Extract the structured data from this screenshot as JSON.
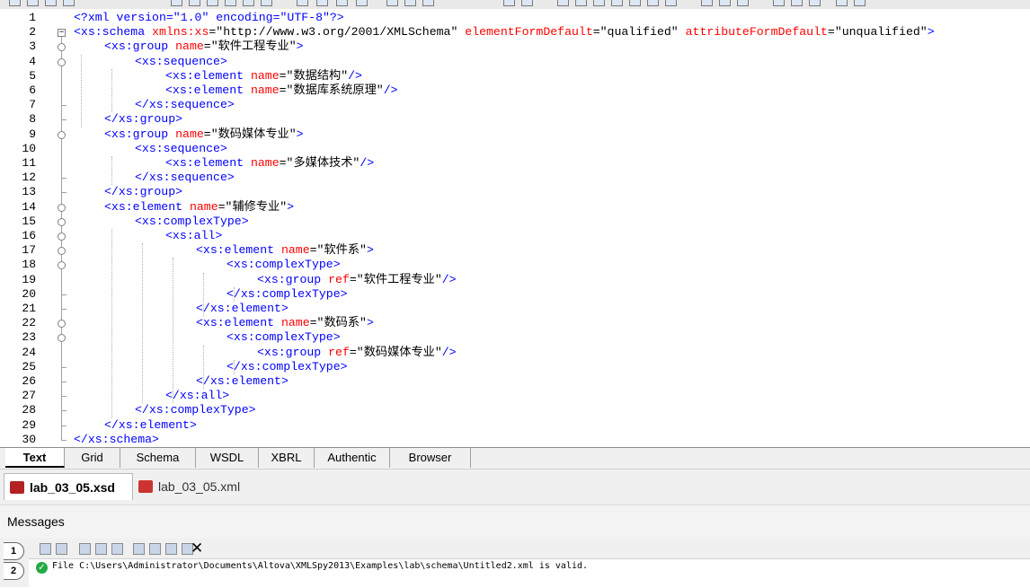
{
  "editor": {
    "line_numbers": [
      "1",
      "2",
      "3",
      "4",
      "5",
      "6",
      "7",
      "8",
      "9",
      "10",
      "11",
      "12",
      "13",
      "14",
      "15",
      "16",
      "17",
      "18",
      "19",
      "20",
      "21",
      "22",
      "23",
      "24",
      "25",
      "26",
      "27",
      "28",
      "29",
      "30"
    ],
    "lines": [
      [
        {
          "c": "pi",
          "t": "<?xml version=\"1.0\" encoding=\"UTF-8\"?>"
        }
      ],
      [
        {
          "c": "t",
          "t": "<xs:schema "
        },
        {
          "c": "a",
          "t": "xmlns:xs"
        },
        {
          "c": "v",
          "t": "=\"http://www.w3.org/2001/XMLSchema\" "
        },
        {
          "c": "a",
          "t": "elementFormDefault"
        },
        {
          "c": "v",
          "t": "=\"qualified\" "
        },
        {
          "c": "a",
          "t": "attributeFormDefault"
        },
        {
          "c": "v",
          "t": "=\"unqualified\""
        },
        {
          "c": "t",
          "t": ">"
        }
      ],
      [
        {
          "c": "t",
          "t": "<xs:group "
        },
        {
          "c": "a",
          "t": "name"
        },
        {
          "c": "v",
          "t": "=\"软件工程专业\""
        },
        {
          "c": "t",
          "t": ">"
        }
      ],
      [
        {
          "c": "t",
          "t": "<xs:sequence>"
        }
      ],
      [
        {
          "c": "t",
          "t": "<xs:element "
        },
        {
          "c": "a",
          "t": "name"
        },
        {
          "c": "v",
          "t": "=\"数据结构\""
        },
        {
          "c": "t",
          "t": "/>"
        }
      ],
      [
        {
          "c": "t",
          "t": "<xs:element "
        },
        {
          "c": "a",
          "t": "name"
        },
        {
          "c": "v",
          "t": "=\"数据库系统原理\""
        },
        {
          "c": "t",
          "t": "/>"
        }
      ],
      [
        {
          "c": "t",
          "t": "</xs:sequence>"
        }
      ],
      [
        {
          "c": "t",
          "t": "</xs:group>"
        }
      ],
      [
        {
          "c": "t",
          "t": "<xs:group "
        },
        {
          "c": "a",
          "t": "name"
        },
        {
          "c": "v",
          "t": "=\"数码媒体专业\""
        },
        {
          "c": "t",
          "t": ">"
        }
      ],
      [
        {
          "c": "t",
          "t": "<xs:sequence>"
        }
      ],
      [
        {
          "c": "t",
          "t": "<xs:element "
        },
        {
          "c": "a",
          "t": "name"
        },
        {
          "c": "v",
          "t": "=\"多媒体技术\""
        },
        {
          "c": "t",
          "t": "/>"
        }
      ],
      [
        {
          "c": "t",
          "t": "</xs:sequence>"
        }
      ],
      [
        {
          "c": "t",
          "t": "</xs:group>"
        }
      ],
      [
        {
          "c": "t",
          "t": "<xs:element "
        },
        {
          "c": "a",
          "t": "name"
        },
        {
          "c": "v",
          "t": "=\"辅修专业\""
        },
        {
          "c": "t",
          "t": ">"
        }
      ],
      [
        {
          "c": "t",
          "t": "<xs:complexType>"
        }
      ],
      [
        {
          "c": "t",
          "t": "<xs:all>"
        }
      ],
      [
        {
          "c": "t",
          "t": "<xs:element "
        },
        {
          "c": "a",
          "t": "name"
        },
        {
          "c": "v",
          "t": "=\"软件系\""
        },
        {
          "c": "t",
          "t": ">"
        }
      ],
      [
        {
          "c": "t",
          "t": "<xs:complexType>"
        }
      ],
      [
        {
          "c": "t",
          "t": "<xs:group "
        },
        {
          "c": "a",
          "t": "ref"
        },
        {
          "c": "v",
          "t": "=\"软件工程专业\""
        },
        {
          "c": "t",
          "t": "/>"
        }
      ],
      [
        {
          "c": "t",
          "t": "</xs:complexType>"
        }
      ],
      [
        {
          "c": "t",
          "t": "</xs:element>"
        }
      ],
      [
        {
          "c": "t",
          "t": "<xs:element "
        },
        {
          "c": "a",
          "t": "name"
        },
        {
          "c": "v",
          "t": "=\"数码系\""
        },
        {
          "c": "t",
          "t": ">"
        }
      ],
      [
        {
          "c": "t",
          "t": "<xs:complexType>"
        }
      ],
      [
        {
          "c": "t",
          "t": "<xs:group "
        },
        {
          "c": "a",
          "t": "ref"
        },
        {
          "c": "v",
          "t": "=\"数码媒体专业\""
        },
        {
          "c": "t",
          "t": "/>"
        }
      ],
      [
        {
          "c": "t",
          "t": "</xs:complexType>"
        }
      ],
      [
        {
          "c": "t",
          "t": "</xs:element>"
        }
      ],
      [
        {
          "c": "t",
          "t": "</xs:all>"
        }
      ],
      [
        {
          "c": "t",
          "t": "</xs:complexType>"
        }
      ],
      [
        {
          "c": "t",
          "t": "</xs:element>"
        }
      ],
      [
        {
          "c": "t",
          "t": "</xs:schema>"
        }
      ]
    ],
    "colors": {
      "tag": "#0000ff",
      "attr": "#ff0000",
      "value": "#000000"
    }
  },
  "view_tabs": [
    "Text",
    "Grid",
    "Schema",
    "WSDL",
    "XBRL",
    "Authentic",
    "Browser"
  ],
  "active_view_tab": "Text",
  "file_tabs": [
    {
      "label": "lab_03_05.xsd",
      "icon": "xsd-file-icon",
      "active": true
    },
    {
      "label": "lab_03_05.xml",
      "icon": "xml-file-icon",
      "active": false
    }
  ],
  "messages": {
    "title": "Messages",
    "side_tabs": [
      "1",
      "2"
    ],
    "status_icon": "check-circle-icon",
    "text": "File C:\\Users\\Administrator\\Documents\\Altova\\XMLSpy2013\\Examples\\lab\\schema\\Untitled2.xml is valid.",
    "ok_glyph": "✓"
  },
  "toolbar_icons": [
    "toolbar-icon"
  ]
}
